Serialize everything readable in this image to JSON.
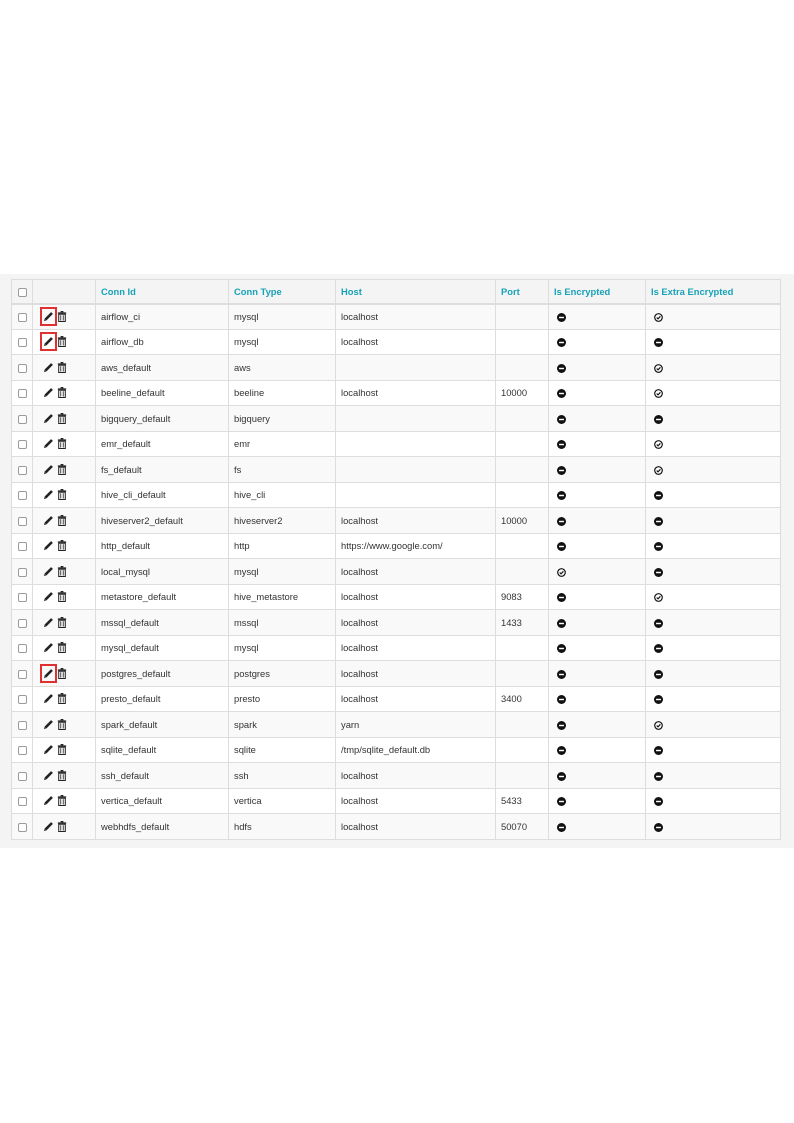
{
  "table": {
    "headers": {
      "conn_id": "Conn Id",
      "conn_type": "Conn Type",
      "host": "Host",
      "port": "Port",
      "is_encrypted": "Is Encrypted",
      "is_extra_encrypted": "Is Extra Encrypted"
    },
    "icons": {
      "edit": "pencil-icon",
      "delete": "trash-icon",
      "false_status": "minus-circle-icon",
      "true_status": "check-circle-icon"
    },
    "colors": {
      "header_link": "#17a2b8",
      "highlight": "#e03131"
    },
    "rows": [
      {
        "conn_id": "airflow_ci",
        "conn_type": "mysql",
        "host": "localhost",
        "port": "",
        "is_encrypted": false,
        "is_extra_encrypted": true,
        "edit_highlighted": true
      },
      {
        "conn_id": "airflow_db",
        "conn_type": "mysql",
        "host": "localhost",
        "port": "",
        "is_encrypted": false,
        "is_extra_encrypted": false,
        "edit_highlighted": true
      },
      {
        "conn_id": "aws_default",
        "conn_type": "aws",
        "host": "",
        "port": "",
        "is_encrypted": false,
        "is_extra_encrypted": true,
        "edit_highlighted": false
      },
      {
        "conn_id": "beeline_default",
        "conn_type": "beeline",
        "host": "localhost",
        "port": "10000",
        "is_encrypted": false,
        "is_extra_encrypted": true,
        "edit_highlighted": false
      },
      {
        "conn_id": "bigquery_default",
        "conn_type": "bigquery",
        "host": "",
        "port": "",
        "is_encrypted": false,
        "is_extra_encrypted": false,
        "edit_highlighted": false
      },
      {
        "conn_id": "emr_default",
        "conn_type": "emr",
        "host": "",
        "port": "",
        "is_encrypted": false,
        "is_extra_encrypted": true,
        "edit_highlighted": false
      },
      {
        "conn_id": "fs_default",
        "conn_type": "fs",
        "host": "",
        "port": "",
        "is_encrypted": false,
        "is_extra_encrypted": true,
        "edit_highlighted": false
      },
      {
        "conn_id": "hive_cli_default",
        "conn_type": "hive_cli",
        "host": "",
        "port": "",
        "is_encrypted": false,
        "is_extra_encrypted": false,
        "edit_highlighted": false
      },
      {
        "conn_id": "hiveserver2_default",
        "conn_type": "hiveserver2",
        "host": "localhost",
        "port": "10000",
        "is_encrypted": false,
        "is_extra_encrypted": false,
        "edit_highlighted": false
      },
      {
        "conn_id": "http_default",
        "conn_type": "http",
        "host": "https://www.google.com/",
        "port": "",
        "is_encrypted": false,
        "is_extra_encrypted": false,
        "edit_highlighted": false
      },
      {
        "conn_id": "local_mysql",
        "conn_type": "mysql",
        "host": "localhost",
        "port": "",
        "is_encrypted": true,
        "is_extra_encrypted": false,
        "edit_highlighted": false
      },
      {
        "conn_id": "metastore_default",
        "conn_type": "hive_metastore",
        "host": "localhost",
        "port": "9083",
        "is_encrypted": false,
        "is_extra_encrypted": true,
        "edit_highlighted": false
      },
      {
        "conn_id": "mssql_default",
        "conn_type": "mssql",
        "host": "localhost",
        "port": "1433",
        "is_encrypted": false,
        "is_extra_encrypted": false,
        "edit_highlighted": false
      },
      {
        "conn_id": "mysql_default",
        "conn_type": "mysql",
        "host": "localhost",
        "port": "",
        "is_encrypted": false,
        "is_extra_encrypted": false,
        "edit_highlighted": false
      },
      {
        "conn_id": "postgres_default",
        "conn_type": "postgres",
        "host": "localhost",
        "port": "",
        "is_encrypted": false,
        "is_extra_encrypted": false,
        "edit_highlighted": true
      },
      {
        "conn_id": "presto_default",
        "conn_type": "presto",
        "host": "localhost",
        "port": "3400",
        "is_encrypted": false,
        "is_extra_encrypted": false,
        "edit_highlighted": false
      },
      {
        "conn_id": "spark_default",
        "conn_type": "spark",
        "host": "yarn",
        "port": "",
        "is_encrypted": false,
        "is_extra_encrypted": true,
        "edit_highlighted": false
      },
      {
        "conn_id": "sqlite_default",
        "conn_type": "sqlite",
        "host": "/tmp/sqlite_default.db",
        "port": "",
        "is_encrypted": false,
        "is_extra_encrypted": false,
        "edit_highlighted": false
      },
      {
        "conn_id": "ssh_default",
        "conn_type": "ssh",
        "host": "localhost",
        "port": "",
        "is_encrypted": false,
        "is_extra_encrypted": false,
        "edit_highlighted": false
      },
      {
        "conn_id": "vertica_default",
        "conn_type": "vertica",
        "host": "localhost",
        "port": "5433",
        "is_encrypted": false,
        "is_extra_encrypted": false,
        "edit_highlighted": false
      },
      {
        "conn_id": "webhdfs_default",
        "conn_type": "hdfs",
        "host": "localhost",
        "port": "50070",
        "is_encrypted": false,
        "is_extra_encrypted": false,
        "edit_highlighted": false
      }
    ]
  }
}
